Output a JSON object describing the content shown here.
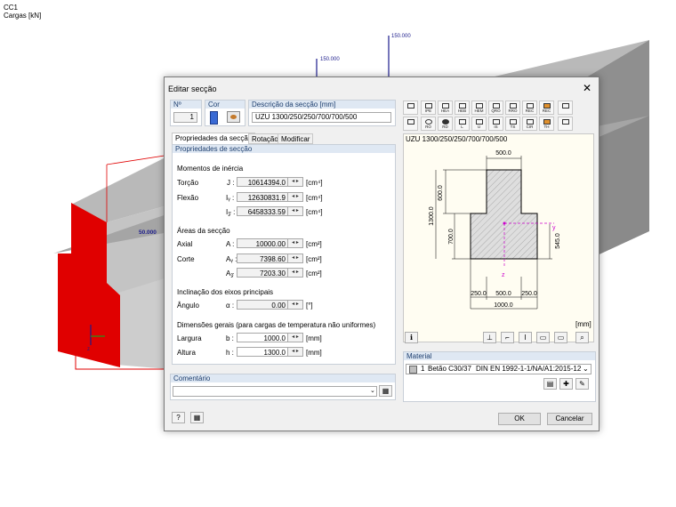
{
  "background": {
    "load_case": "CC1",
    "load_units": "Cargas [kN]",
    "load_values": [
      "150.000",
      "150.000",
      "50.000"
    ],
    "axis_label": "z"
  },
  "dialog": {
    "title": "Editar secção",
    "no_label": "Nº",
    "no_value": "1",
    "color_label": "Cor",
    "description_label": "Descrição da secção [mm]",
    "description_value": "UZU 1300/250/250/700/700/500",
    "tabs": [
      "Propriedades da secção",
      "Rotação",
      "Modificar"
    ],
    "section_props": {
      "header": "Propriedades de secção",
      "inertia_title": "Momentos de inércia",
      "torsion_label": "Torção",
      "torsion_sym": "J :",
      "torsion_value": "10614394.0",
      "torsion_unit": "[cm⁴]",
      "flexion_label": "Flexão",
      "iy_sym": "Iᵧ :",
      "iy_value": "12630831.9",
      "iy_unit": "[cm⁴]",
      "iz_sym": "I𝓏 :",
      "iz_value": "6458333.59",
      "iz_unit": "[cm⁴]",
      "areas_title": "Áreas da secção",
      "axial_label": "Axial",
      "a_sym": "A :",
      "a_value": "10000.00",
      "a_unit": "[cm²]",
      "shear_label": "Corte",
      "ay_sym": "Aᵧ :",
      "ay_value": "7398.60",
      "ay_unit": "[cm²]",
      "az_sym": "A𝓏 :",
      "az_value": "7203.30",
      "az_unit": "[cm²]",
      "incl_title": "Inclinação dos eixos principais",
      "angle_label": "Ângulo",
      "alpha_sym": "α :",
      "alpha_value": "0.00",
      "alpha_unit": "[°]",
      "dims_title": "Dimensões gerais (para cargas de temperatura não uniformes)",
      "width_label": "Largura",
      "b_sym": "b :",
      "b_value": "1000.0",
      "b_unit": "[mm]",
      "height_label": "Altura",
      "h_sym": "h :",
      "h_value": "1300.0",
      "h_unit": "[mm]"
    },
    "comment_label": "Comentário",
    "comment_value": "",
    "section_name": "UZU 1300/250/250/700/700/500",
    "units_mm": "[mm]",
    "drawing_dims": {
      "top_width": "500.0",
      "top_height": "600.0",
      "total_height": "1300.0",
      "bottom_height": "700.0",
      "right_height": "545.0",
      "left_flange": "250.0",
      "mid_width": "500.0",
      "right_flange": "250.0",
      "total_width": "1000.0",
      "axis_y": "y",
      "axis_z": "z"
    },
    "section_toolbar_row1": [
      "IPE",
      "HEA",
      "HEB",
      "HEM",
      "QRO",
      "RRO",
      "REC",
      "REC"
    ],
    "section_toolbar_row2": [
      "RO",
      "RD",
      "L",
      "U",
      "IS",
      "TS",
      "CIR",
      "TH"
    ],
    "material_label": "Material",
    "material_no": "1",
    "material_name": "Betão C30/37",
    "material_norm": "DIN EN 1992-1-1/NA/A1:2015-12",
    "ok_label": "OK",
    "cancel_label": "Cancelar",
    "colors": {
      "accent": "#dfe8f3",
      "section_fill": "#d9d9d9",
      "red_member": "#e00000",
      "load_blue": "#1c1c8c",
      "axis_magenta": "#cc00cc"
    }
  }
}
